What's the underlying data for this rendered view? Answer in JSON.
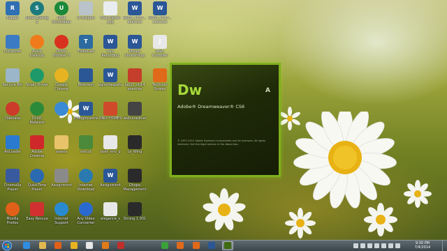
{
  "desktop": {
    "icons": [
      {
        "label": "Ruppie",
        "color": "#2f6fb3",
        "glyph": "R",
        "round": false
      },
      {
        "label": "Smart Defrag 5",
        "color": "#1b7a7d",
        "glyph": "S",
        "round": true
      },
      {
        "label": "IObit Uninstaller",
        "color": "#1a8a3a",
        "glyph": "U",
        "round": true
      },
      {
        "label": "dr-dropbit",
        "color": "#b9c3c9",
        "glyph": "",
        "round": false
      },
      {
        "label": "Description and installat...",
        "color": "#e9edf0",
        "glyph": "",
        "round": false
      },
      {
        "label": "lab02_ch12... exercise",
        "color": "#2b5797",
        "glyph": "W",
        "round": false
      },
      {
        "label": "lab03_ch13... exercise",
        "color": "#2b5797",
        "glyph": "W",
        "round": false
      },
      {
        "label": "Computer",
        "color": "#3b7bc4",
        "glyph": "",
        "round": false
      },
      {
        "label": "Avast Cleanup",
        "color": "#f07b1a",
        "glyph": "",
        "round": true
      },
      {
        "label": "Driver Booster 3",
        "color": "#d9321f",
        "glyph": "",
        "round": true
      },
      {
        "label": "TurboCad",
        "color": "#2c6aa0",
        "glyph": "T",
        "round": false
      },
      {
        "label": "Lab Recording Listing",
        "color": "#2b5797",
        "glyph": "W",
        "round": false
      },
      {
        "label": "libcam nbcamtings",
        "color": "#2b5797",
        "glyph": "W",
        "round": false
      },
      {
        "label": "JAVA Compiler",
        "color": "#e8e8e8",
        "glyph": "J",
        "round": false
      },
      {
        "label": "Recycle Bin",
        "color": "#9bb6c8",
        "glyph": "",
        "round": false
      },
      {
        "label": "Smart Driver",
        "color": "#1e9a6a",
        "glyph": "",
        "round": true
      },
      {
        "label": "Google Chrome",
        "color": "#e8b321",
        "glyph": "",
        "round": true
      },
      {
        "label": "Bfoiment",
        "color": "#2b5797",
        "glyph": "",
        "round": false
      },
      {
        "label": "egiomtaspats",
        "color": "#2b5797",
        "glyph": "W",
        "round": false
      },
      {
        "label": "lab11_ch14 exercise",
        "color": "#c43e2b",
        "glyph": "",
        "round": false
      },
      {
        "label": "Techrum Screen",
        "color": "#e06a1a",
        "glyph": "",
        "round": false
      },
      {
        "label": "Odenasa",
        "color": "#cc3a2a",
        "glyph": "",
        "round": true
      },
      {
        "label": "Chinh Malware",
        "color": "#2a8a3a",
        "glyph": "",
        "round": true
      },
      {
        "label": "",
        "color": "#3a8ad6",
        "glyph": "",
        "round": true
      },
      {
        "label": "Emoglocastre",
        "color": "#2b5797",
        "glyph": "W",
        "round": false
      },
      {
        "label": "ONLY HOMES",
        "color": "#d04a2a",
        "glyph": "",
        "round": false
      },
      {
        "label": "web eradrive",
        "color": "#444",
        "glyph": "",
        "round": false
      },
      {
        "label": "AirLoader",
        "color": "#2a7ad0",
        "glyph": "",
        "round": false
      },
      {
        "label": "Adobe Creative",
        "color": "#d0282a",
        "glyph": "",
        "round": false
      },
      {
        "label": "assets",
        "color": "#e8c36a",
        "glyph": "",
        "round": false
      },
      {
        "label": "netcut",
        "color": "#4a8a3a",
        "glyph": "",
        "round": false
      },
      {
        "label": "tasik_env_p",
        "color": "#e8e8e8",
        "glyph": "",
        "round": false
      },
      {
        "label": "ca_Wing",
        "color": "#2a2a2a",
        "glyph": "",
        "round": false
      },
      {
        "label": "Cinemalia Player",
        "color": "#3a5aa0",
        "glyph": "",
        "round": false
      },
      {
        "label": "QuickTime Player",
        "color": "#2a6ab0",
        "glyph": "",
        "round": true
      },
      {
        "label": "Assignment",
        "color": "#8a8a8a",
        "glyph": "",
        "round": false
      },
      {
        "label": "Internet Download",
        "color": "#2a7ab0",
        "glyph": "",
        "round": true
      },
      {
        "label": "Assignment",
        "color": "#2b5797",
        "glyph": "W",
        "round": false
      },
      {
        "label": "Dhope Management",
        "color": "#2a2a2a",
        "glyph": "",
        "round": false
      },
      {
        "label": "Mozilla Firefox",
        "color": "#e0601a",
        "glyph": "",
        "round": true
      },
      {
        "label": "Easy Rescue",
        "color": "#d03030",
        "glyph": "",
        "round": false
      },
      {
        "label": "Internet Support",
        "color": "#2a8ad0",
        "glyph": "",
        "round": true
      },
      {
        "label": "Any Video Converter",
        "color": "#2a6ad0",
        "glyph": "",
        "round": true
      },
      {
        "label": "elegance_s",
        "color": "#e8e8e8",
        "glyph": "",
        "round": false
      },
      {
        "label": "Strong 1.001",
        "color": "#2a2a2a",
        "glyph": "",
        "round": false
      }
    ]
  },
  "splash": {
    "logo": "Dw",
    "title": "Adobe® Dreamweaver® CS6",
    "adobe_mark": "A",
    "copyright": "© 1997-2012 Adobe Systems Incorporated and its licensors. All rights reserved. See the legal notices in the About box."
  },
  "taskbar": {
    "apps": [
      {
        "name": "taskbar-ie",
        "color": "#2f8de0"
      },
      {
        "name": "taskbar-explorer",
        "color": "#e0b850"
      },
      {
        "name": "taskbar-firefox",
        "color": "#e0601a"
      },
      {
        "name": "taskbar-chrome",
        "color": "#e8b321"
      },
      {
        "name": "taskbar-media",
        "color": "#e8e8e8"
      },
      {
        "name": "taskbar-avast",
        "color": "#e07a1a"
      },
      {
        "name": "taskbar-app-red",
        "color": "#c0302a"
      },
      {
        "name": "taskbar-app-green",
        "color": "#3aa03a"
      },
      {
        "name": "taskbar-app-orange",
        "color": "#e06a1a"
      },
      {
        "name": "taskbar-app-orange-2",
        "color": "#e06a1a"
      },
      {
        "name": "taskbar-word",
        "color": "#2b5797"
      },
      {
        "name": "taskbar-dreamweaver",
        "color": "#3e6a10"
      }
    ],
    "clock_time": "9:30 PM",
    "clock_date": "7/4/2014"
  }
}
